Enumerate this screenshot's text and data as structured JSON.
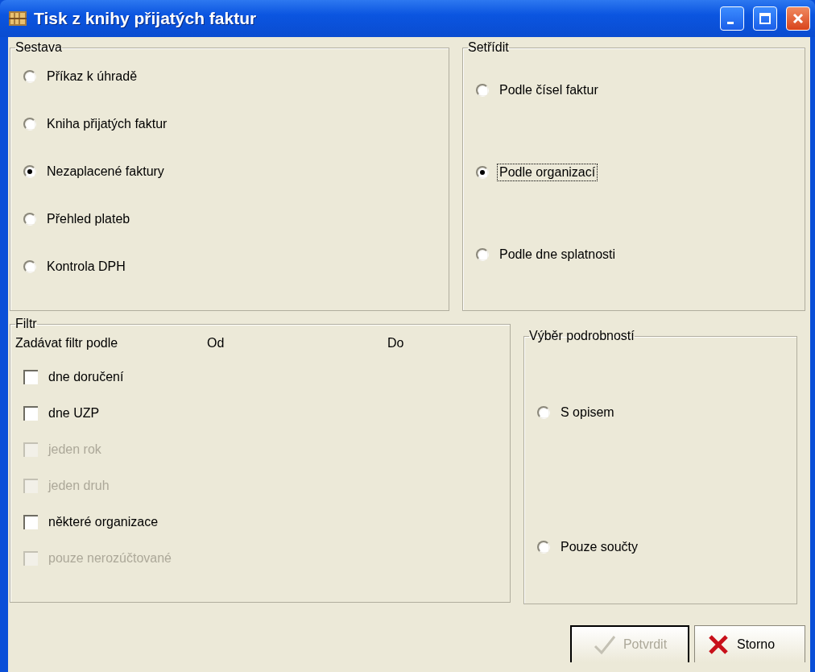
{
  "window": {
    "title": "Tisk z knihy přijatých faktur"
  },
  "sestava": {
    "title": "Sestava",
    "options": [
      {
        "label": "Příkaz k úhradě",
        "selected": false
      },
      {
        "label": "Kniha přijatých faktur",
        "selected": false
      },
      {
        "label": "Nezaplacené faktury",
        "selected": true
      },
      {
        "label": "Přehled plateb",
        "selected": false
      },
      {
        "label": "Kontrola DPH",
        "selected": false
      }
    ]
  },
  "setridit": {
    "title": "Setřídit",
    "options": [
      {
        "label": "Podle čísel faktur",
        "selected": false,
        "focused": false
      },
      {
        "label": "Podle organizací",
        "selected": true,
        "focused": true
      },
      {
        "label": "Podle dne splatnosti",
        "selected": false,
        "focused": false
      }
    ]
  },
  "filtr": {
    "title": "Filtr",
    "header": "Zadávat filtr podle",
    "from_label": "Od",
    "to_label": "Do",
    "items": [
      {
        "label": "dne doručení",
        "checked": false,
        "disabled": false
      },
      {
        "label": "dne UZP",
        "checked": false,
        "disabled": false
      },
      {
        "label": "jeden rok",
        "checked": false,
        "disabled": true
      },
      {
        "label": "jeden druh",
        "checked": false,
        "disabled": true
      },
      {
        "label": "některé organizace",
        "checked": false,
        "disabled": false
      },
      {
        "label": "pouze nerozúčtované",
        "checked": false,
        "disabled": true
      }
    ]
  },
  "vyber": {
    "title": "Výběr podrobností",
    "options": [
      {
        "label": "S opisem",
        "selected": false
      },
      {
        "label": "Pouze součty",
        "selected": false
      }
    ]
  },
  "buttons": [
    {
      "label": "Potvrdit",
      "kind": "confirm",
      "disabled": true,
      "default": true
    },
    {
      "label": "Storno",
      "kind": "cancel",
      "disabled": false,
      "default": false
    }
  ]
}
